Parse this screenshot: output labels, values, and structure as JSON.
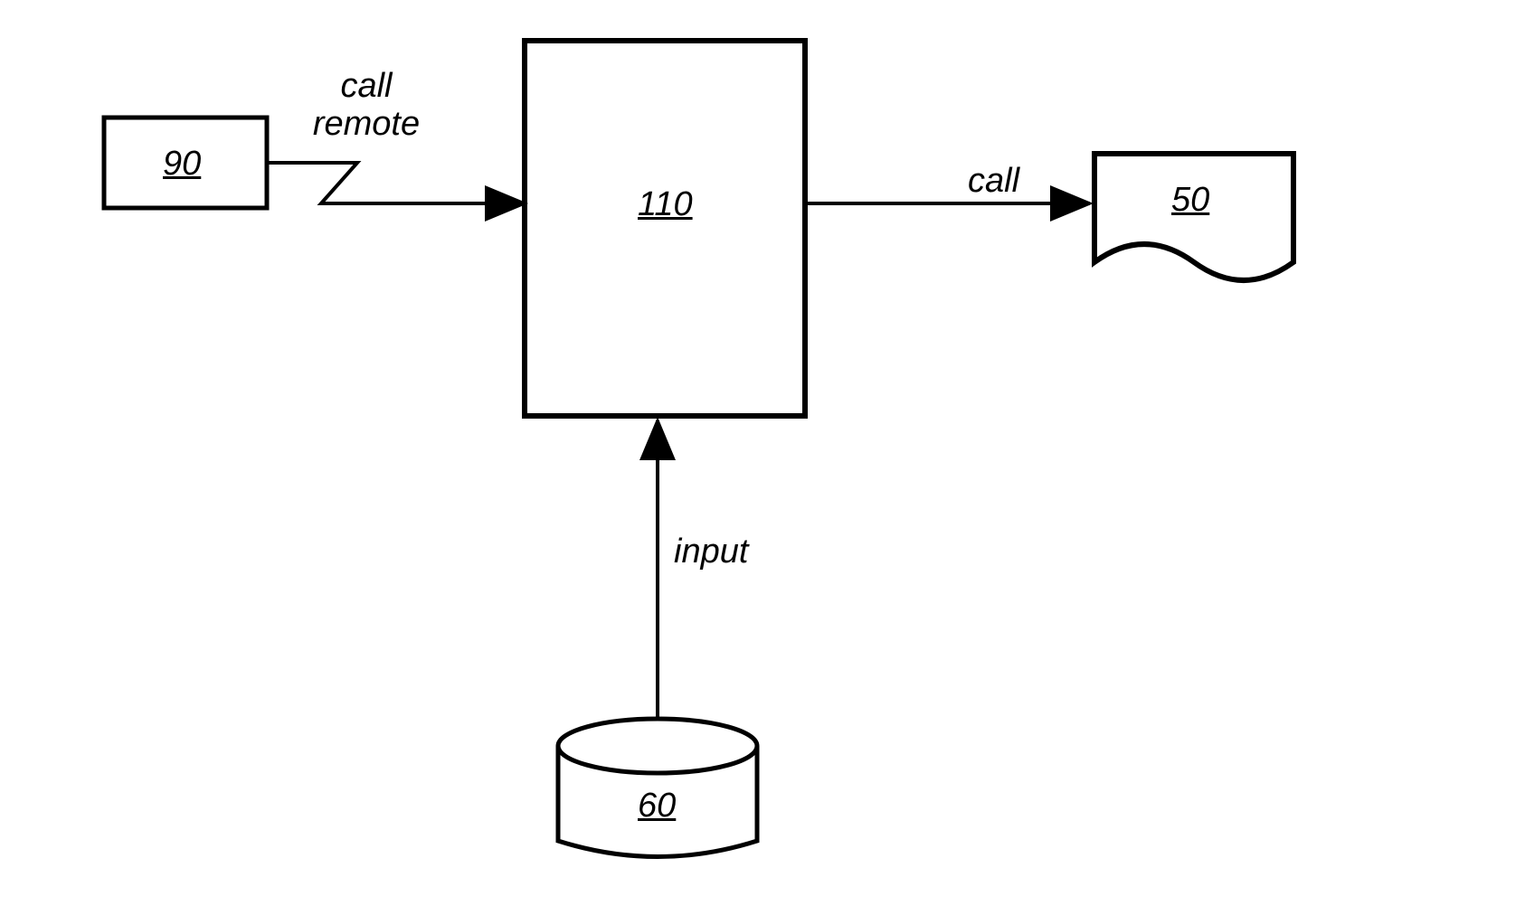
{
  "nodes": {
    "box90": {
      "ref": "90"
    },
    "box110": {
      "ref": "110"
    },
    "doc50": {
      "ref": "50"
    },
    "db60": {
      "ref": "60"
    }
  },
  "edges": {
    "callRemote": {
      "line1": "call",
      "line2": "remote"
    },
    "call": {
      "label": "call"
    },
    "input": {
      "label": "input"
    }
  }
}
